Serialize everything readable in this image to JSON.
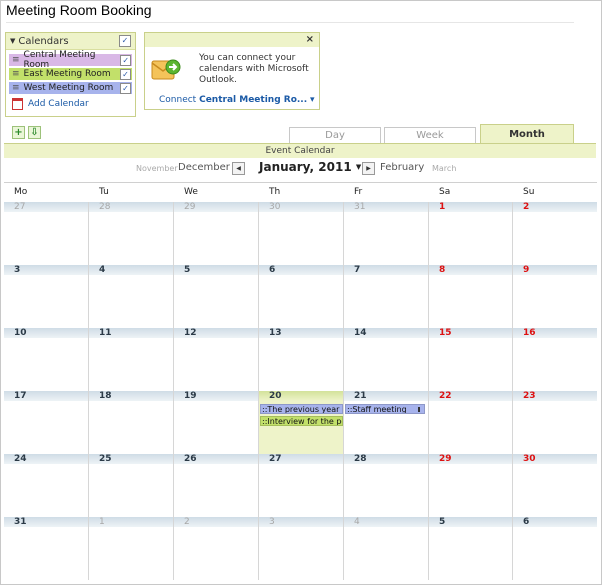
{
  "page": {
    "title": "Meeting Room Booking"
  },
  "calendars_panel": {
    "header": "Calendars",
    "items": [
      {
        "label": "Central Meeting Room",
        "checked": true,
        "color": "#d9b8e6"
      },
      {
        "label": "East Meeting Room",
        "checked": true,
        "color": "#c2e06a"
      },
      {
        "label": "West Meeting Room",
        "checked": true,
        "color": "#a7b3ec"
      }
    ],
    "add_label": "Add Calendar"
  },
  "outlook_panel": {
    "close": "×",
    "message": "You can connect your calendars with Microsoft Outlook.",
    "connect_prefix": "Connect",
    "connect_target": "Central Meeting Ro...",
    "connect_dropdown": "▾"
  },
  "toolbar": {
    "add_icon": "+",
    "export_icon": "⇩"
  },
  "tabs": {
    "day": "Day",
    "week": "Week",
    "month": "Month",
    "active": "month"
  },
  "event_calendar_title": "Event Calendar",
  "month_nav": {
    "far_prev": "November",
    "prev": "December",
    "current": "January, 2011",
    "next": "February",
    "far_next": "March"
  },
  "weekdays": [
    "Mo",
    "Tu",
    "We",
    "Th",
    "Fr",
    "Sa",
    "Su"
  ],
  "weeks": [
    [
      "27",
      "28",
      "29",
      "30",
      "31",
      "1",
      "2"
    ],
    [
      "3",
      "4",
      "5",
      "6",
      "7",
      "8",
      "9"
    ],
    [
      "10",
      "11",
      "12",
      "13",
      "14",
      "15",
      "16"
    ],
    [
      "17",
      "18",
      "19",
      "20",
      "21",
      "22",
      "23"
    ],
    [
      "24",
      "25",
      "26",
      "27",
      "28",
      "29",
      "30"
    ],
    [
      "31",
      "1",
      "2",
      "3",
      "4",
      "5",
      "6"
    ]
  ],
  "events": [
    {
      "text": "::The previous year re",
      "day": "20",
      "calendar": "West Meeting Room"
    },
    {
      "text": "::Interview for the post",
      "day": "20",
      "calendar": "East Meeting Room"
    },
    {
      "text": "::Staff meeting",
      "day": "21",
      "calendar": "West Meeting Room"
    }
  ],
  "colors": {
    "accent": "#eef3c9",
    "weekend_date": "#dd1111",
    "link": "#1b5aa6",
    "today": "#eef3c9"
  }
}
